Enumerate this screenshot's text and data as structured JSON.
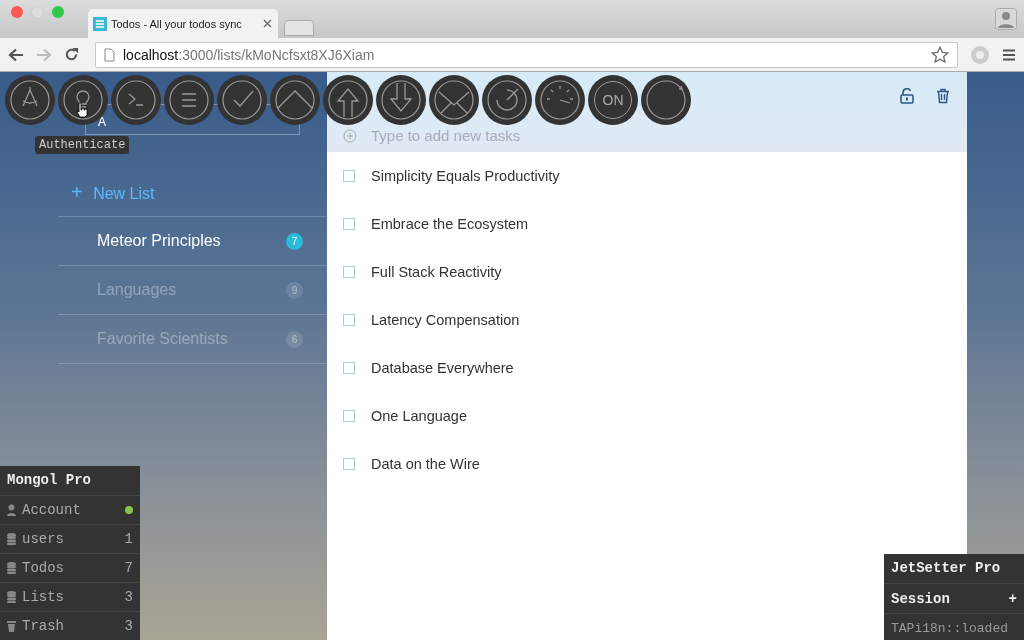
{
  "browser": {
    "tab_title": "Todos - All your todos sync",
    "url_host": "localhost",
    "url_path": ":3000/lists/kMoNcfsxt8XJ6Xiam"
  },
  "tools": [
    {
      "kind": "compass"
    },
    {
      "kind": "bulb"
    },
    {
      "kind": "terminal"
    },
    {
      "kind": "menu"
    },
    {
      "kind": "check"
    },
    {
      "kind": "arch"
    },
    {
      "kind": "upload"
    },
    {
      "kind": "download"
    },
    {
      "kind": "mail"
    },
    {
      "kind": "radar"
    },
    {
      "kind": "gauge"
    },
    {
      "kind": "on",
      "label": "ON"
    },
    {
      "kind": "refresh"
    }
  ],
  "tooltip": "Authenticate",
  "login_field": {
    "value": "A"
  },
  "sidebar": {
    "new_list_icon": "+",
    "new_list": "New List",
    "lists": [
      {
        "name": "Meteor Principles",
        "count": "7",
        "selected": true
      },
      {
        "name": "Languages",
        "count": "9",
        "selected": false
      },
      {
        "name": "Favorite Scientists",
        "count": "6",
        "selected": false
      }
    ]
  },
  "main": {
    "placeholder": "Type to add new tasks",
    "tasks": [
      {
        "text": "Simplicity Equals Productivity",
        "checked": false
      },
      {
        "text": "Embrace the Ecosystem",
        "checked": false
      },
      {
        "text": "Full Stack Reactivity",
        "checked": false
      },
      {
        "text": "Latency Compensation",
        "checked": false
      },
      {
        "text": "Database Everywhere",
        "checked": false
      },
      {
        "text": "One Language",
        "checked": false
      },
      {
        "text": "Data on the Wire",
        "checked": false
      }
    ]
  },
  "mongol": {
    "title": "Mongol Pro",
    "rows": [
      {
        "kind": "account",
        "label": "Account",
        "online": true
      },
      {
        "kind": "collection",
        "label": "users",
        "count": "1"
      },
      {
        "kind": "collection",
        "label": "Todos",
        "count": "7"
      },
      {
        "kind": "collection",
        "label": "Lists",
        "count": "3"
      },
      {
        "kind": "trash",
        "label": "Trash",
        "count": "3"
      }
    ]
  },
  "jetsetter": {
    "title": "JetSetter Pro",
    "section": "Session",
    "add": "+",
    "rows": [
      "TAPi18n::loaded"
    ]
  }
}
